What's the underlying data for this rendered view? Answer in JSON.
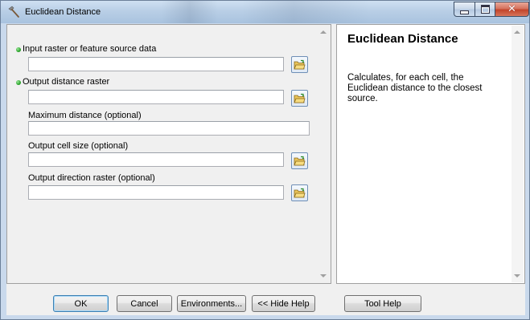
{
  "window": {
    "title": "Euclidean Distance"
  },
  "parameters": [
    {
      "label": "Input raster or feature source data",
      "required": true,
      "value": "",
      "has_browse": true
    },
    {
      "label": "Output distance raster",
      "required": true,
      "value": "",
      "has_browse": true
    },
    {
      "label": "Maximum distance (optional)",
      "required": false,
      "value": "",
      "has_browse": false
    },
    {
      "label": "Output cell size (optional)",
      "required": false,
      "value": "",
      "has_browse": true
    },
    {
      "label": "Output direction raster (optional)",
      "required": false,
      "value": "",
      "has_browse": true
    }
  ],
  "help": {
    "title": "Euclidean Distance",
    "description": "Calculates, for each cell, the Euclidean distance to the closest source."
  },
  "buttons": {
    "ok": "OK",
    "cancel": "Cancel",
    "environments": "Environments...",
    "hide_help": "<< Hide Help",
    "tool_help": "Tool Help"
  },
  "icons": {
    "tool": "hammer-icon",
    "browse": "open-folder-icon"
  },
  "colors": {
    "required_bullet": "#29a329",
    "default_button_border": "#3c7fb1",
    "close_button": "#c2442a"
  }
}
